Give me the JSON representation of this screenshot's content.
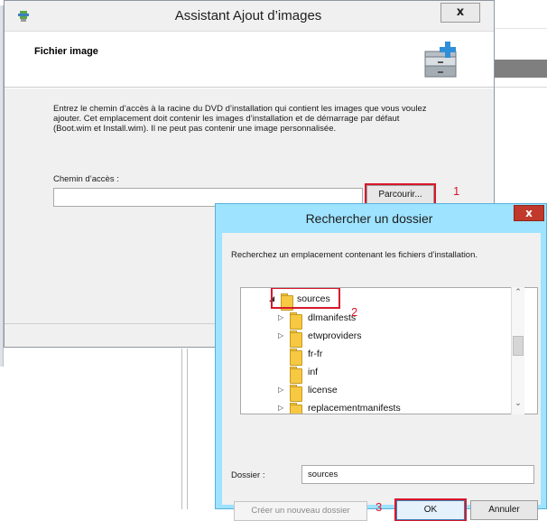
{
  "wizard": {
    "title": "Assistant Ajout d’images",
    "close_label": "x",
    "section_title": "Fichier image",
    "description": "Entrez le chemin d’accès à la racine du DVD d’installation qui contient les images que vous voulez ajouter. Cet emplacement doit contenir les images d’installation et de démarrage par défaut (Boot.wim et Install.wim). Il ne peut pas contenir une image personnalisée.",
    "path_label": "Chemin d’accès :",
    "path_value": "",
    "browse_label": "Parcourir...",
    "callout_1": "1"
  },
  "dialog": {
    "title": "Rechercher un dossier",
    "close_label": "x",
    "instruction": "Recherchez un emplacement contenant les fichiers d’installation.",
    "tree": {
      "selected": "sources",
      "items": [
        {
          "label": "sources",
          "expanded": true,
          "has_children": true
        },
        {
          "label": "dlmanifests",
          "has_children": true
        },
        {
          "label": "etwproviders",
          "has_children": true
        },
        {
          "label": "fr-fr",
          "has_children": false
        },
        {
          "label": "inf",
          "has_children": false
        },
        {
          "label": "license",
          "has_children": true
        },
        {
          "label": "replacementmanifests",
          "has_children": true
        }
      ]
    },
    "callout_2": "2",
    "folder_label": "Dossier :",
    "folder_value": "sources",
    "new_folder_label": "Créer un nouveau dossier",
    "callout_3": "3",
    "ok_label": "OK",
    "cancel_label": "Annuler"
  },
  "colors": {
    "highlight_red": "#d9172b",
    "dialog_frame": "#9ee3ff",
    "folder_yellow": "#f7c842"
  }
}
